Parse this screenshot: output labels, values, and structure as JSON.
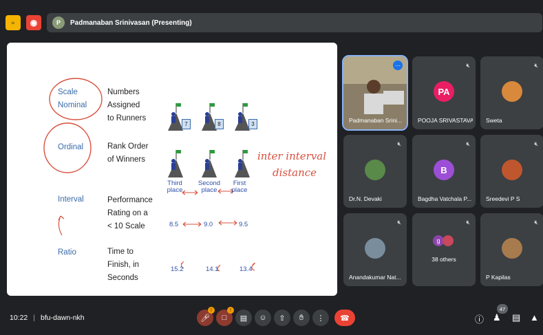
{
  "topbar": {
    "presenter_label": "Padmanaban Srinivasan (Presenting)"
  },
  "slide": {
    "scale_label": "Scale",
    "rows": [
      {
        "scale": "Nominal",
        "desc": [
          "Numbers",
          "Assigned",
          "to Runners"
        ]
      },
      {
        "scale": "Ordinal",
        "desc": [
          "Rank Order",
          "of Winners"
        ]
      },
      {
        "scale": "Interval",
        "desc": [
          "Performance",
          "Rating on a",
          "< 10 Scale"
        ]
      },
      {
        "scale": "Ratio",
        "desc": [
          "Time to",
          "Finish, in",
          "Seconds"
        ]
      }
    ],
    "runner_numbers": [
      "7",
      "8",
      "3"
    ],
    "places": [
      "Third place",
      "Second place",
      "First place"
    ],
    "interval_values": [
      "8.5",
      "9.0",
      "9.5"
    ],
    "ratio_values": [
      "15.2",
      "14.1",
      "13.4"
    ],
    "handwriting": [
      "inter interval",
      "distance"
    ]
  },
  "participants": [
    {
      "name": "Padmanaban Srini...",
      "type": "video",
      "muted": false
    },
    {
      "name": "POOJA SRIVASTAVA",
      "type": "avatar",
      "initials": "PA",
      "color": "#e91e63",
      "muted": true
    },
    {
      "name": "Sweta",
      "type": "avatar",
      "initials": "",
      "color": "#d9893b",
      "muted": true
    },
    {
      "name": "Dr.N. Devaki",
      "type": "avatar",
      "initials": "",
      "color": "#5a8a4a",
      "muted": true
    },
    {
      "name": "Bagdha Vatchala P...",
      "type": "avatar",
      "initials": "B",
      "color": "#9c4fd6",
      "muted": true
    },
    {
      "name": "Sreedevi P S",
      "type": "avatar",
      "initials": "",
      "color": "#c0562e",
      "muted": true
    },
    {
      "name": "Anandakumar Nat...",
      "type": "avatar",
      "initials": "",
      "color": "#7a8d9c",
      "muted": true
    },
    {
      "name": "38 others",
      "type": "others",
      "initials": "g",
      "color": "#8e44ad",
      "muted": true
    },
    {
      "name": "P Kapilas",
      "type": "avatar",
      "initials": "",
      "color": "#a77b4e",
      "muted": true
    }
  ],
  "bottombar": {
    "time": "10:22",
    "meeting_code": "bfu-dawn-nkh",
    "people_count": "47"
  },
  "icons": {
    "mute": "mic-off-icon",
    "more": "more-vert-icon"
  }
}
